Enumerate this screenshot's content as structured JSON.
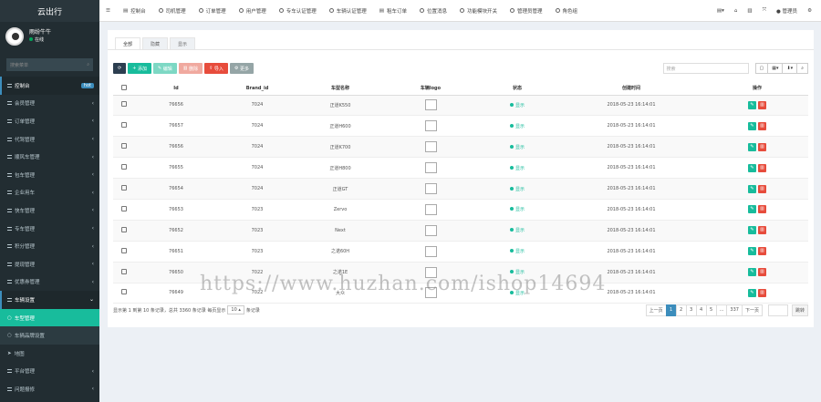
{
  "brand": "云出行",
  "user": {
    "name": "雨纷牛牛",
    "status": "在线"
  },
  "sidebar": {
    "search_placeholder": "搜索菜单",
    "items": [
      {
        "label": "控制台",
        "badge": "hot"
      },
      {
        "label": "会员管理"
      },
      {
        "label": "订单管理"
      },
      {
        "label": "代驾管理"
      },
      {
        "label": "顺风车管理"
      },
      {
        "label": "包车管理"
      },
      {
        "label": "企业用车"
      },
      {
        "label": "快车管理"
      },
      {
        "label": "专车管理"
      },
      {
        "label": "积分管理"
      },
      {
        "label": "提现管理"
      },
      {
        "label": "优惠券管理"
      },
      {
        "label": "车辆设置"
      },
      {
        "label": "车型管理"
      },
      {
        "label": "车辆品牌设置"
      },
      {
        "label": "地图"
      },
      {
        "label": "平台管理"
      },
      {
        "label": "问题报修"
      }
    ]
  },
  "topbar": {
    "tabs": [
      "控制台",
      "司机管理",
      "订单管理",
      "用户管理",
      "专车认证管理",
      "车辆认证管理",
      "租车订单",
      "位置消息",
      "功能模块开关",
      "管理员管理",
      "角色组"
    ],
    "user": "管理员"
  },
  "panel": {
    "tabs": [
      "全部",
      "隐藏",
      "显示"
    ],
    "toolbar": {
      "add": "添加",
      "edit": "编辑",
      "delete": "删除",
      "import": "导入",
      "more": "更多"
    },
    "search_placeholder": "搜索",
    "columns": [
      "Id",
      "Brand_id",
      "车型名称",
      "车辆logo",
      "状态",
      "创建时间",
      "操作"
    ],
    "rows": [
      {
        "id": "76656",
        "brand_id": "7024",
        "name": "正道K550",
        "status": "显示",
        "time": "2018-05-23 16:14:01"
      },
      {
        "id": "76657",
        "brand_id": "7024",
        "name": "正道H600",
        "status": "显示",
        "time": "2018-05-23 16:14:01"
      },
      {
        "id": "76656",
        "brand_id": "7024",
        "name": "正道K700",
        "status": "显示",
        "time": "2018-05-23 16:14:01"
      },
      {
        "id": "76655",
        "brand_id": "7024",
        "name": "正道H800",
        "status": "显示",
        "time": "2018-05-23 16:14:01"
      },
      {
        "id": "76654",
        "brand_id": "7024",
        "name": "正道GT",
        "status": "显示",
        "time": "2018-05-23 16:14:01"
      },
      {
        "id": "76653",
        "brand_id": "7023",
        "name": "Zervo",
        "status": "显示",
        "time": "2018-05-23 16:14:01"
      },
      {
        "id": "76652",
        "brand_id": "7023",
        "name": "Next",
        "status": "显示",
        "time": "2018-05-23 16:14:01"
      },
      {
        "id": "76651",
        "brand_id": "7023",
        "name": "之诺60H",
        "status": "显示",
        "time": "2018-05-23 16:14:01"
      },
      {
        "id": "76650",
        "brand_id": "7022",
        "name": "之诺1E",
        "status": "显示",
        "time": "2018-05-23 16:14:01"
      },
      {
        "id": "76649",
        "brand_id": "7022",
        "name": "大众",
        "status": "显示",
        "time": "2018-05-23 16:14:01"
      }
    ],
    "footer": {
      "summary": "显示第 1 到第 10 条记录，总共 3360 条记录 每页显示",
      "page_size": "10",
      "suffix": "条记录"
    },
    "pagination": {
      "prev": "上一页",
      "pages": [
        "1",
        "2",
        "3",
        "4",
        "5",
        "...",
        "337"
      ],
      "next": "下一页",
      "go": "跳转"
    }
  },
  "watermark": "https://www.huzhan.com/ishop14694"
}
